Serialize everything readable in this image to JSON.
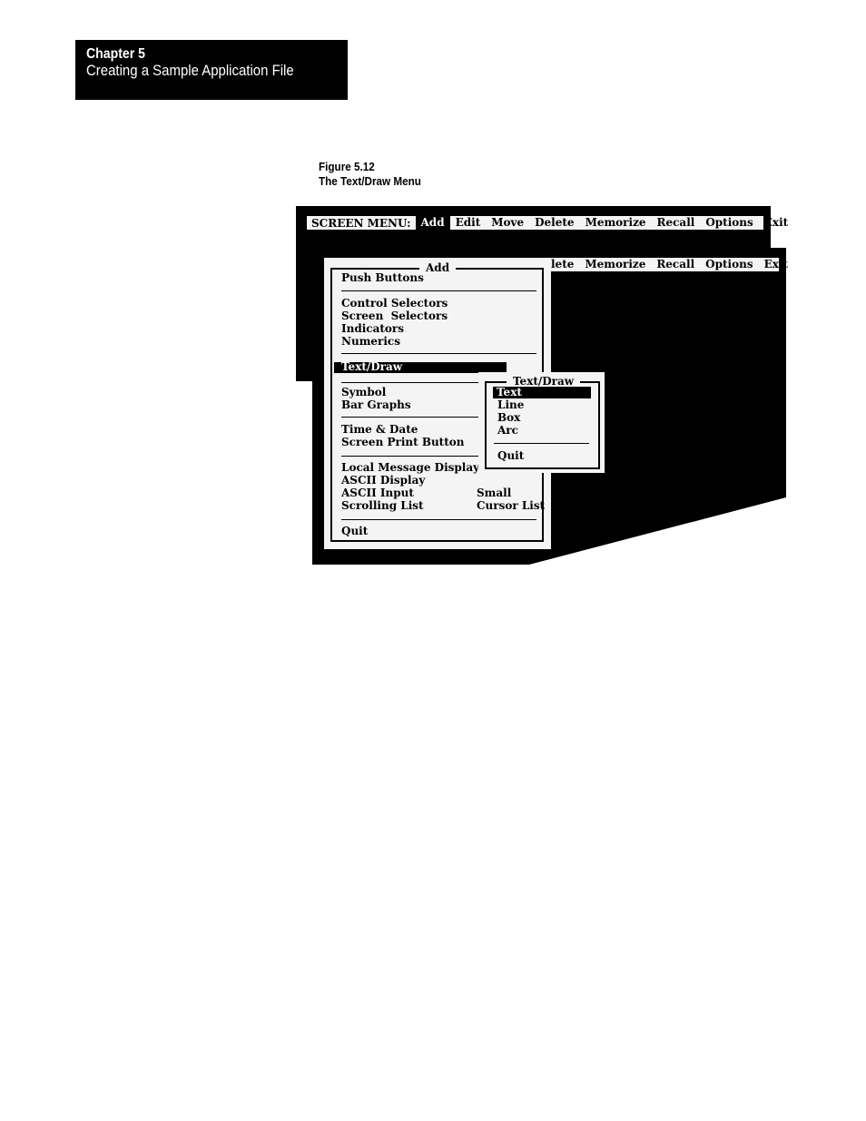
{
  "chapter": {
    "number": "Chapter 5",
    "title": "Creating a Sample Application File"
  },
  "figure": {
    "number": "Figure 5.12",
    "title": "The Text/Draw Menu"
  },
  "screen_menu": {
    "label": "SCREEN MENU:",
    "items": [
      "Add",
      "Edit",
      "Move",
      "Delete",
      "Memorize",
      "Recall",
      "Options",
      "Exit"
    ],
    "active": "Add"
  },
  "back_menu": {
    "items": [
      "lete",
      "Memorize",
      "Recall",
      "Options",
      "Exit"
    ]
  },
  "add_menu": {
    "title": "Add",
    "groups": [
      [
        "Push Buttons"
      ],
      [
        "Control Selectors",
        "Screen  Selectors",
        "Indicators",
        "Numerics"
      ],
      [
        "Text/Draw"
      ],
      [
        "Symbol",
        "Bar Graphs"
      ],
      [
        "Time & Date",
        "Screen Print Button"
      ],
      [
        "Local Message Display",
        "ASCII Display",
        "ASCII Input",
        "Scrolling List"
      ],
      [
        "Quit"
      ]
    ],
    "right_items": [
      "Small",
      "Cursor List"
    ],
    "selected": "Text/Draw"
  },
  "textdraw_menu": {
    "title": "Text/Draw",
    "items": [
      "Text",
      "Line",
      "Box",
      "Arc"
    ],
    "quit": "Quit",
    "selected": "Text"
  },
  "colors": {
    "screen_background": "#000000",
    "panel_background": "#f4f4f4",
    "highlight": "#000000",
    "highlight_text": "#ffffff"
  }
}
